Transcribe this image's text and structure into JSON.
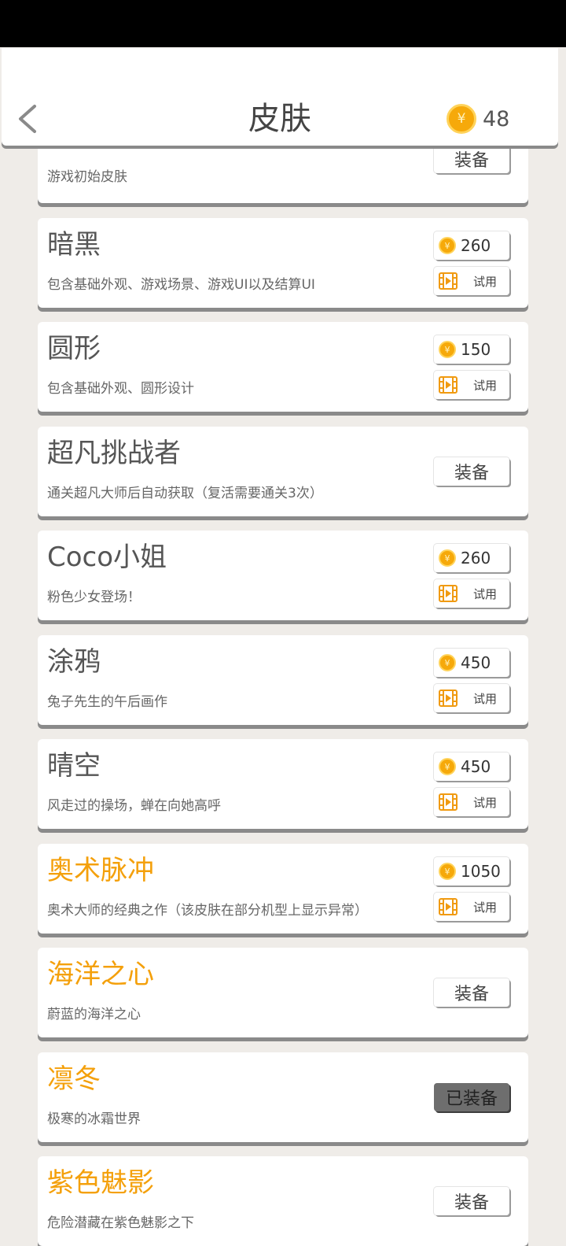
{
  "header": {
    "title": "皮肤",
    "coins": "48",
    "coin_symbol": "¥"
  },
  "skins": [
    {
      "name": "",
      "name_color": "grey",
      "desc": "游戏初始皮肤",
      "mode": "equip",
      "button_label": "装备"
    },
    {
      "name": "暗黑",
      "name_color": "grey",
      "desc": "包含基础外观、游戏场景、游戏UI以及结算UI",
      "mode": "buy",
      "price": "260",
      "try_label": "试用"
    },
    {
      "name": "圆形",
      "name_color": "grey",
      "desc": "包含基础外观、圆形设计",
      "mode": "buy",
      "price": "150",
      "try_label": "试用"
    },
    {
      "name": "超凡挑战者",
      "name_color": "grey",
      "desc": "通关超凡大师后自动获取（复活需要通关3次）",
      "mode": "equip",
      "button_label": "装备"
    },
    {
      "name": "Coco小姐",
      "name_color": "grey",
      "desc": "粉色少女登场！",
      "mode": "buy",
      "price": "260",
      "try_label": "试用"
    },
    {
      "name": "涂鸦",
      "name_color": "grey",
      "desc": "兔子先生的午后画作",
      "mode": "buy",
      "price": "450",
      "try_label": "试用"
    },
    {
      "name": "晴空",
      "name_color": "grey",
      "desc": "风走过的操场，蝉在向她高呼",
      "mode": "buy",
      "price": "450",
      "try_label": "试用"
    },
    {
      "name": "奥术脉冲",
      "name_color": "gold",
      "desc": "奥术大师的经典之作（该皮肤在部分机型上显示异常）",
      "mode": "buy",
      "price": "1050",
      "try_label": "试用"
    },
    {
      "name": "海洋之心",
      "name_color": "gold",
      "desc": "蔚蓝的海洋之心",
      "mode": "equip",
      "button_label": "装备"
    },
    {
      "name": "凛冬",
      "name_color": "gold",
      "desc": "极寒的冰霜世界",
      "mode": "equipped",
      "button_label": "已装备"
    },
    {
      "name": "紫色魅影",
      "name_color": "gold",
      "desc": "危险潜藏在紫色魅影之下",
      "mode": "equip",
      "button_label": "装备"
    }
  ],
  "colors": {
    "gold_title": "#f4a00b",
    "grey_title": "#555555",
    "background": "#efece8",
    "coin": "#f6a90a"
  },
  "icons": {
    "back": "chevron-left-icon",
    "coin": "coin-icon",
    "video": "video-icon"
  }
}
